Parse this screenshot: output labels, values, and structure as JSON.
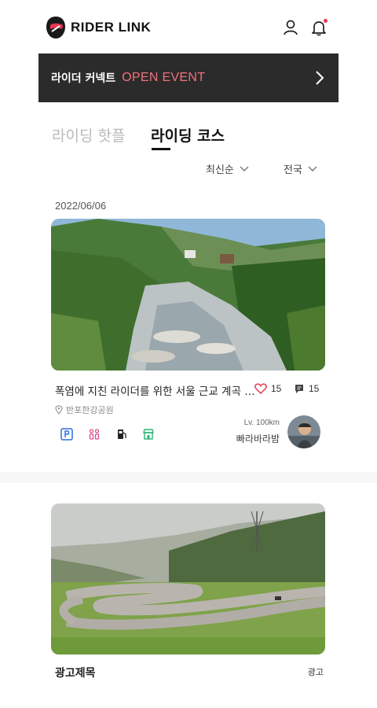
{
  "header": {
    "brand": "RIDER LINK",
    "icons": [
      "user-icon",
      "bell-icon"
    ],
    "notification_dot": true
  },
  "banner": {
    "label_kr": "라이더 커넥트",
    "label_en": "OPEN EVENT",
    "accent_color": "#f3707c"
  },
  "tabs": [
    {
      "label": "라이딩 핫플",
      "active": false
    },
    {
      "label": "라이딩 코스",
      "active": true
    }
  ],
  "filters": {
    "sort": "최신순",
    "region": "전국"
  },
  "courses": [
    {
      "date": "2022/06/06",
      "title": "폭염에 지친 라이더를 위한 서울 근교 계곡 라이딩",
      "likes": "15",
      "comments": "15",
      "location": "반포한강공원",
      "amenities": [
        "parking-icon",
        "restroom-icon",
        "gas-station-icon",
        "store-icon"
      ],
      "rider": {
        "level": "Lv. 100km",
        "name": "빠라바라밤"
      }
    }
  ],
  "ad": {
    "title": "광고제목",
    "badge": "광고"
  },
  "colors": {
    "brand_red": "#e8384f",
    "banner_bg": "#2b2b2b"
  }
}
